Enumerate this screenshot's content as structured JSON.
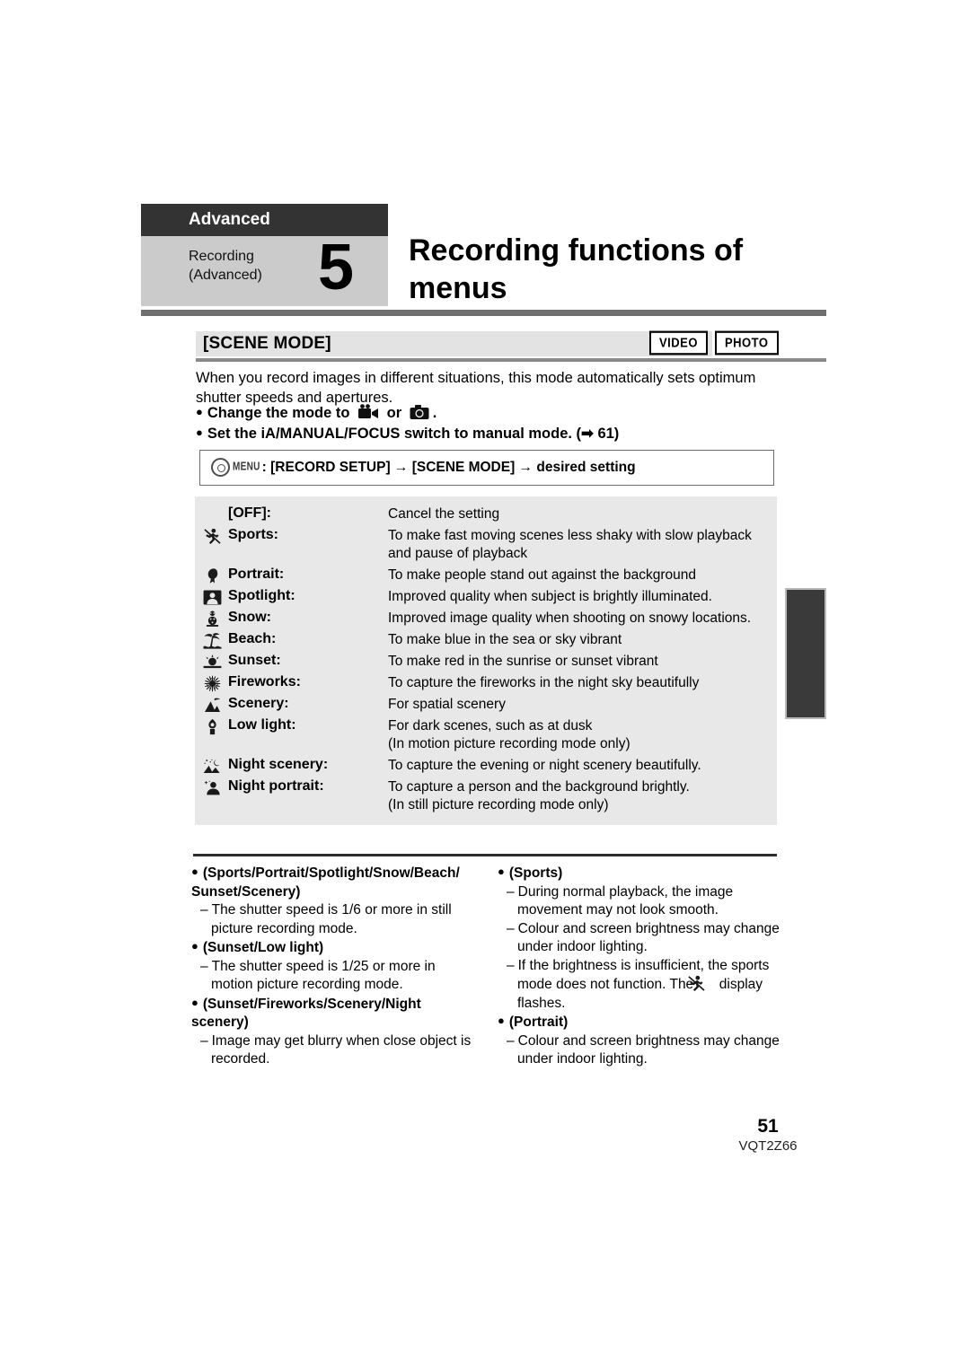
{
  "chapter": {
    "bar_label": "Advanced",
    "sub_line1": "Recording",
    "sub_line2": "(Advanced)",
    "number": "5",
    "title": "Recording functions of menus"
  },
  "section": {
    "heading": "[SCENE MODE]",
    "badge_video": "VIDEO",
    "badge_photo": "PHOTO"
  },
  "intro": {
    "paragraph": "When you record images in different situations, this mode automatically sets optimum shutter speeds and apertures.",
    "bullet1_pre": "Change the mode to",
    "bullet1_mid": "or",
    "bullet1_post": ".",
    "bullet2": "Set the iA/MANUAL/FOCUS switch to manual mode. (➡ 61)"
  },
  "menu_path": {
    "menu_word": "MENU",
    "text": ": [RECORD SETUP] → [SCENE MODE] → desired setting"
  },
  "scene_table": {
    "rows": [
      {
        "icon": "none",
        "name": "[OFF]:",
        "desc": "Cancel the setting"
      },
      {
        "icon": "sports-icon",
        "name": "Sports:",
        "desc": "To make fast moving scenes less shaky with slow playback and pause of playback"
      },
      {
        "icon": "portrait-icon",
        "name": "Portrait:",
        "desc": "To make people stand out against the background"
      },
      {
        "icon": "spotlight-icon",
        "name": "Spotlight:",
        "desc": "Improved quality when subject is brightly illuminated."
      },
      {
        "icon": "snow-icon",
        "name": "Snow:",
        "desc": "Improved image quality when shooting on snowy locations."
      },
      {
        "icon": "beach-icon",
        "name": "Beach:",
        "desc": "To make blue in the sea or sky vibrant"
      },
      {
        "icon": "sunset-icon",
        "name": "Sunset:",
        "desc": "To make red in the sunrise or sunset vibrant"
      },
      {
        "icon": "fireworks-icon",
        "name": "Fireworks:",
        "desc": "To capture the fireworks in the night sky beautifully"
      },
      {
        "icon": "scenery-icon",
        "name": "Scenery:",
        "desc": "For spatial scenery"
      },
      {
        "icon": "lowlight-icon",
        "name": "Low light:",
        "desc": "For dark scenes, such as at dusk\n(In motion picture recording mode only)"
      },
      {
        "icon": "night-scenery-icon",
        "name": "Night scenery:",
        "desc": "To capture the evening or night scenery beautifully."
      },
      {
        "icon": "night-portrait-icon",
        "name": "Night portrait:",
        "desc": "To capture a person and the background brightly.\n(In still picture recording mode only)"
      }
    ]
  },
  "notes": {
    "left": [
      {
        "head": "(Sports/Portrait/Spotlight/Snow/Beach/ Sunset/Scenery)",
        "items": [
          "The shutter speed is 1/6 or more in still picture recording mode."
        ]
      },
      {
        "head": "(Sunset/Low light)",
        "items": [
          "The shutter speed is 1/25 or more in motion picture recording mode."
        ]
      },
      {
        "head": "(Sunset/Fireworks/Scenery/Night scenery)",
        "items": [
          "Image may get blurry when close object is recorded."
        ]
      }
    ],
    "right": [
      {
        "head": "(Sports)",
        "items": [
          "During normal playback, the image movement may not look smooth.",
          "Colour and screen brightness may change under indoor lighting.",
          "If the brightness is insufficient, the sports mode does not function. The ## display flashes."
        ]
      },
      {
        "head": "(Portrait)",
        "items": [
          "Colour and screen brightness may change under indoor lighting."
        ]
      }
    ]
  },
  "footer": {
    "page_number": "51",
    "doc_id": "VQT2Z66"
  },
  "colors": {
    "chapter_bar": "#333333",
    "chapter_body": "#cbcbcb",
    "rule": "#6f6f6f",
    "section_bg": "#e3e3e3",
    "table_bg": "#e8e8e8",
    "side_tab": "#3a3a3a"
  }
}
